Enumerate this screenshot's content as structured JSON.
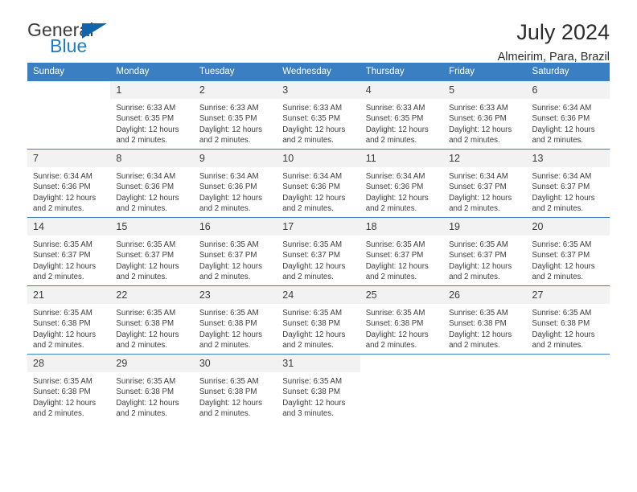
{
  "brand": {
    "name_top": "General",
    "name_bottom": "Blue",
    "triangle_color": "#1064ab",
    "blue_color": "#1f7ac4"
  },
  "header": {
    "title": "July 2024",
    "subtitle": "Almeirim, Para, Brazil"
  },
  "theme": {
    "header_row_bg": "#3a7fc1",
    "daynum_bg": "#f2f2f2",
    "text": "#3d3d3d"
  },
  "weekday_headers": [
    "Sunday",
    "Monday",
    "Tuesday",
    "Wednesday",
    "Thursday",
    "Friday",
    "Saturday"
  ],
  "weeks": [
    [
      {
        "day": "",
        "sunrise": "",
        "sunset": "",
        "daylight_line1": "",
        "daylight_line2": "",
        "empty": true
      },
      {
        "day": "1",
        "sunrise": "Sunrise: 6:33 AM",
        "sunset": "Sunset: 6:35 PM",
        "daylight_line1": "Daylight: 12 hours",
        "daylight_line2": "and 2 minutes.",
        "empty": false
      },
      {
        "day": "2",
        "sunrise": "Sunrise: 6:33 AM",
        "sunset": "Sunset: 6:35 PM",
        "daylight_line1": "Daylight: 12 hours",
        "daylight_line2": "and 2 minutes.",
        "empty": false
      },
      {
        "day": "3",
        "sunrise": "Sunrise: 6:33 AM",
        "sunset": "Sunset: 6:35 PM",
        "daylight_line1": "Daylight: 12 hours",
        "daylight_line2": "and 2 minutes.",
        "empty": false
      },
      {
        "day": "4",
        "sunrise": "Sunrise: 6:33 AM",
        "sunset": "Sunset: 6:35 PM",
        "daylight_line1": "Daylight: 12 hours",
        "daylight_line2": "and 2 minutes.",
        "empty": false
      },
      {
        "day": "5",
        "sunrise": "Sunrise: 6:33 AM",
        "sunset": "Sunset: 6:36 PM",
        "daylight_line1": "Daylight: 12 hours",
        "daylight_line2": "and 2 minutes.",
        "empty": false
      },
      {
        "day": "6",
        "sunrise": "Sunrise: 6:34 AM",
        "sunset": "Sunset: 6:36 PM",
        "daylight_line1": "Daylight: 12 hours",
        "daylight_line2": "and 2 minutes.",
        "empty": false
      }
    ],
    [
      {
        "day": "7",
        "sunrise": "Sunrise: 6:34 AM",
        "sunset": "Sunset: 6:36 PM",
        "daylight_line1": "Daylight: 12 hours",
        "daylight_line2": "and 2 minutes.",
        "empty": false
      },
      {
        "day": "8",
        "sunrise": "Sunrise: 6:34 AM",
        "sunset": "Sunset: 6:36 PM",
        "daylight_line1": "Daylight: 12 hours",
        "daylight_line2": "and 2 minutes.",
        "empty": false
      },
      {
        "day": "9",
        "sunrise": "Sunrise: 6:34 AM",
        "sunset": "Sunset: 6:36 PM",
        "daylight_line1": "Daylight: 12 hours",
        "daylight_line2": "and 2 minutes.",
        "empty": false
      },
      {
        "day": "10",
        "sunrise": "Sunrise: 6:34 AM",
        "sunset": "Sunset: 6:36 PM",
        "daylight_line1": "Daylight: 12 hours",
        "daylight_line2": "and 2 minutes.",
        "empty": false
      },
      {
        "day": "11",
        "sunrise": "Sunrise: 6:34 AM",
        "sunset": "Sunset: 6:36 PM",
        "daylight_line1": "Daylight: 12 hours",
        "daylight_line2": "and 2 minutes.",
        "empty": false
      },
      {
        "day": "12",
        "sunrise": "Sunrise: 6:34 AM",
        "sunset": "Sunset: 6:37 PM",
        "daylight_line1": "Daylight: 12 hours",
        "daylight_line2": "and 2 minutes.",
        "empty": false
      },
      {
        "day": "13",
        "sunrise": "Sunrise: 6:34 AM",
        "sunset": "Sunset: 6:37 PM",
        "daylight_line1": "Daylight: 12 hours",
        "daylight_line2": "and 2 minutes.",
        "empty": false
      }
    ],
    [
      {
        "day": "14",
        "sunrise": "Sunrise: 6:35 AM",
        "sunset": "Sunset: 6:37 PM",
        "daylight_line1": "Daylight: 12 hours",
        "daylight_line2": "and 2 minutes.",
        "empty": false
      },
      {
        "day": "15",
        "sunrise": "Sunrise: 6:35 AM",
        "sunset": "Sunset: 6:37 PM",
        "daylight_line1": "Daylight: 12 hours",
        "daylight_line2": "and 2 minutes.",
        "empty": false
      },
      {
        "day": "16",
        "sunrise": "Sunrise: 6:35 AM",
        "sunset": "Sunset: 6:37 PM",
        "daylight_line1": "Daylight: 12 hours",
        "daylight_line2": "and 2 minutes.",
        "empty": false
      },
      {
        "day": "17",
        "sunrise": "Sunrise: 6:35 AM",
        "sunset": "Sunset: 6:37 PM",
        "daylight_line1": "Daylight: 12 hours",
        "daylight_line2": "and 2 minutes.",
        "empty": false
      },
      {
        "day": "18",
        "sunrise": "Sunrise: 6:35 AM",
        "sunset": "Sunset: 6:37 PM",
        "daylight_line1": "Daylight: 12 hours",
        "daylight_line2": "and 2 minutes.",
        "empty": false
      },
      {
        "day": "19",
        "sunrise": "Sunrise: 6:35 AM",
        "sunset": "Sunset: 6:37 PM",
        "daylight_line1": "Daylight: 12 hours",
        "daylight_line2": "and 2 minutes.",
        "empty": false
      },
      {
        "day": "20",
        "sunrise": "Sunrise: 6:35 AM",
        "sunset": "Sunset: 6:37 PM",
        "daylight_line1": "Daylight: 12 hours",
        "daylight_line2": "and 2 minutes.",
        "empty": false
      }
    ],
    [
      {
        "day": "21",
        "sunrise": "Sunrise: 6:35 AM",
        "sunset": "Sunset: 6:38 PM",
        "daylight_line1": "Daylight: 12 hours",
        "daylight_line2": "and 2 minutes.",
        "empty": false
      },
      {
        "day": "22",
        "sunrise": "Sunrise: 6:35 AM",
        "sunset": "Sunset: 6:38 PM",
        "daylight_line1": "Daylight: 12 hours",
        "daylight_line2": "and 2 minutes.",
        "empty": false
      },
      {
        "day": "23",
        "sunrise": "Sunrise: 6:35 AM",
        "sunset": "Sunset: 6:38 PM",
        "daylight_line1": "Daylight: 12 hours",
        "daylight_line2": "and 2 minutes.",
        "empty": false
      },
      {
        "day": "24",
        "sunrise": "Sunrise: 6:35 AM",
        "sunset": "Sunset: 6:38 PM",
        "daylight_line1": "Daylight: 12 hours",
        "daylight_line2": "and 2 minutes.",
        "empty": false
      },
      {
        "day": "25",
        "sunrise": "Sunrise: 6:35 AM",
        "sunset": "Sunset: 6:38 PM",
        "daylight_line1": "Daylight: 12 hours",
        "daylight_line2": "and 2 minutes.",
        "empty": false
      },
      {
        "day": "26",
        "sunrise": "Sunrise: 6:35 AM",
        "sunset": "Sunset: 6:38 PM",
        "daylight_line1": "Daylight: 12 hours",
        "daylight_line2": "and 2 minutes.",
        "empty": false
      },
      {
        "day": "27",
        "sunrise": "Sunrise: 6:35 AM",
        "sunset": "Sunset: 6:38 PM",
        "daylight_line1": "Daylight: 12 hours",
        "daylight_line2": "and 2 minutes.",
        "empty": false
      }
    ],
    [
      {
        "day": "28",
        "sunrise": "Sunrise: 6:35 AM",
        "sunset": "Sunset: 6:38 PM",
        "daylight_line1": "Daylight: 12 hours",
        "daylight_line2": "and 2 minutes.",
        "empty": false
      },
      {
        "day": "29",
        "sunrise": "Sunrise: 6:35 AM",
        "sunset": "Sunset: 6:38 PM",
        "daylight_line1": "Daylight: 12 hours",
        "daylight_line2": "and 2 minutes.",
        "empty": false
      },
      {
        "day": "30",
        "sunrise": "Sunrise: 6:35 AM",
        "sunset": "Sunset: 6:38 PM",
        "daylight_line1": "Daylight: 12 hours",
        "daylight_line2": "and 2 minutes.",
        "empty": false
      },
      {
        "day": "31",
        "sunrise": "Sunrise: 6:35 AM",
        "sunset": "Sunset: 6:38 PM",
        "daylight_line1": "Daylight: 12 hours",
        "daylight_line2": "and 3 minutes.",
        "empty": false
      },
      {
        "day": "",
        "sunrise": "",
        "sunset": "",
        "daylight_line1": "",
        "daylight_line2": "",
        "empty": true
      },
      {
        "day": "",
        "sunrise": "",
        "sunset": "",
        "daylight_line1": "",
        "daylight_line2": "",
        "empty": true
      },
      {
        "day": "",
        "sunrise": "",
        "sunset": "",
        "daylight_line1": "",
        "daylight_line2": "",
        "empty": true
      }
    ]
  ]
}
